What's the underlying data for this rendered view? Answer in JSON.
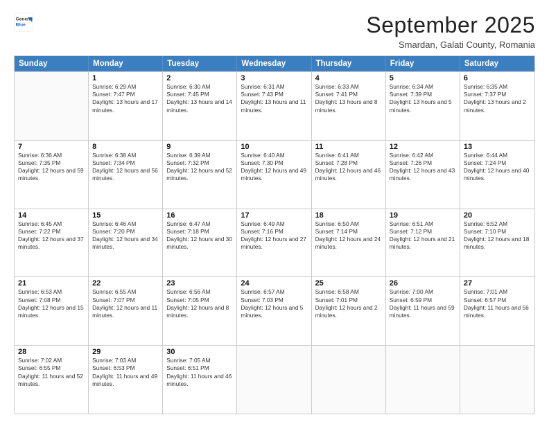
{
  "logo": {
    "general": "General",
    "blue": "Blue"
  },
  "header": {
    "month": "September 2025",
    "location": "Smardan, Galati County, Romania"
  },
  "weekdays": [
    "Sunday",
    "Monday",
    "Tuesday",
    "Wednesday",
    "Thursday",
    "Friday",
    "Saturday"
  ],
  "weeks": [
    [
      {
        "date": "",
        "sunrise": "",
        "sunset": "",
        "daylight": ""
      },
      {
        "date": "1",
        "sunrise": "Sunrise: 6:29 AM",
        "sunset": "Sunset: 7:47 PM",
        "daylight": "Daylight: 13 hours and 17 minutes."
      },
      {
        "date": "2",
        "sunrise": "Sunrise: 6:30 AM",
        "sunset": "Sunset: 7:45 PM",
        "daylight": "Daylight: 13 hours and 14 minutes."
      },
      {
        "date": "3",
        "sunrise": "Sunrise: 6:31 AM",
        "sunset": "Sunset: 7:43 PM",
        "daylight": "Daylight: 13 hours and 11 minutes."
      },
      {
        "date": "4",
        "sunrise": "Sunrise: 6:33 AM",
        "sunset": "Sunset: 7:41 PM",
        "daylight": "Daylight: 13 hours and 8 minutes."
      },
      {
        "date": "5",
        "sunrise": "Sunrise: 6:34 AM",
        "sunset": "Sunset: 7:39 PM",
        "daylight": "Daylight: 13 hours and 5 minutes."
      },
      {
        "date": "6",
        "sunrise": "Sunrise: 6:35 AM",
        "sunset": "Sunset: 7:37 PM",
        "daylight": "Daylight: 13 hours and 2 minutes."
      }
    ],
    [
      {
        "date": "7",
        "sunrise": "Sunrise: 6:36 AM",
        "sunset": "Sunset: 7:35 PM",
        "daylight": "Daylight: 12 hours and 59 minutes."
      },
      {
        "date": "8",
        "sunrise": "Sunrise: 6:38 AM",
        "sunset": "Sunset: 7:34 PM",
        "daylight": "Daylight: 12 hours and 56 minutes."
      },
      {
        "date": "9",
        "sunrise": "Sunrise: 6:39 AM",
        "sunset": "Sunset: 7:32 PM",
        "daylight": "Daylight: 12 hours and 52 minutes."
      },
      {
        "date": "10",
        "sunrise": "Sunrise: 6:40 AM",
        "sunset": "Sunset: 7:30 PM",
        "daylight": "Daylight: 12 hours and 49 minutes."
      },
      {
        "date": "11",
        "sunrise": "Sunrise: 6:41 AM",
        "sunset": "Sunset: 7:28 PM",
        "daylight": "Daylight: 12 hours and 46 minutes."
      },
      {
        "date": "12",
        "sunrise": "Sunrise: 6:42 AM",
        "sunset": "Sunset: 7:26 PM",
        "daylight": "Daylight: 12 hours and 43 minutes."
      },
      {
        "date": "13",
        "sunrise": "Sunrise: 6:44 AM",
        "sunset": "Sunset: 7:24 PM",
        "daylight": "Daylight: 12 hours and 40 minutes."
      }
    ],
    [
      {
        "date": "14",
        "sunrise": "Sunrise: 6:45 AM",
        "sunset": "Sunset: 7:22 PM",
        "daylight": "Daylight: 12 hours and 37 minutes."
      },
      {
        "date": "15",
        "sunrise": "Sunrise: 6:46 AM",
        "sunset": "Sunset: 7:20 PM",
        "daylight": "Daylight: 12 hours and 34 minutes."
      },
      {
        "date": "16",
        "sunrise": "Sunrise: 6:47 AM",
        "sunset": "Sunset: 7:18 PM",
        "daylight": "Daylight: 12 hours and 30 minutes."
      },
      {
        "date": "17",
        "sunrise": "Sunrise: 6:49 AM",
        "sunset": "Sunset: 7:16 PM",
        "daylight": "Daylight: 12 hours and 27 minutes."
      },
      {
        "date": "18",
        "sunrise": "Sunrise: 6:50 AM",
        "sunset": "Sunset: 7:14 PM",
        "daylight": "Daylight: 12 hours and 24 minutes."
      },
      {
        "date": "19",
        "sunrise": "Sunrise: 6:51 AM",
        "sunset": "Sunset: 7:12 PM",
        "daylight": "Daylight: 12 hours and 21 minutes."
      },
      {
        "date": "20",
        "sunrise": "Sunrise: 6:52 AM",
        "sunset": "Sunset: 7:10 PM",
        "daylight": "Daylight: 12 hours and 18 minutes."
      }
    ],
    [
      {
        "date": "21",
        "sunrise": "Sunrise: 6:53 AM",
        "sunset": "Sunset: 7:08 PM",
        "daylight": "Daylight: 12 hours and 15 minutes."
      },
      {
        "date": "22",
        "sunrise": "Sunrise: 6:55 AM",
        "sunset": "Sunset: 7:07 PM",
        "daylight": "Daylight: 12 hours and 11 minutes."
      },
      {
        "date": "23",
        "sunrise": "Sunrise: 6:56 AM",
        "sunset": "Sunset: 7:05 PM",
        "daylight": "Daylight: 12 hours and 8 minutes."
      },
      {
        "date": "24",
        "sunrise": "Sunrise: 6:57 AM",
        "sunset": "Sunset: 7:03 PM",
        "daylight": "Daylight: 12 hours and 5 minutes."
      },
      {
        "date": "25",
        "sunrise": "Sunrise: 6:58 AM",
        "sunset": "Sunset: 7:01 PM",
        "daylight": "Daylight: 12 hours and 2 minutes."
      },
      {
        "date": "26",
        "sunrise": "Sunrise: 7:00 AM",
        "sunset": "Sunset: 6:59 PM",
        "daylight": "Daylight: 11 hours and 59 minutes."
      },
      {
        "date": "27",
        "sunrise": "Sunrise: 7:01 AM",
        "sunset": "Sunset: 6:57 PM",
        "daylight": "Daylight: 11 hours and 56 minutes."
      }
    ],
    [
      {
        "date": "28",
        "sunrise": "Sunrise: 7:02 AM",
        "sunset": "Sunset: 6:55 PM",
        "daylight": "Daylight: 11 hours and 52 minutes."
      },
      {
        "date": "29",
        "sunrise": "Sunrise: 7:03 AM",
        "sunset": "Sunset: 6:53 PM",
        "daylight": "Daylight: 11 hours and 49 minutes."
      },
      {
        "date": "30",
        "sunrise": "Sunrise: 7:05 AM",
        "sunset": "Sunset: 6:51 PM",
        "daylight": "Daylight: 11 hours and 46 minutes."
      },
      {
        "date": "",
        "sunrise": "",
        "sunset": "",
        "daylight": ""
      },
      {
        "date": "",
        "sunrise": "",
        "sunset": "",
        "daylight": ""
      },
      {
        "date": "",
        "sunrise": "",
        "sunset": "",
        "daylight": ""
      },
      {
        "date": "",
        "sunrise": "",
        "sunset": "",
        "daylight": ""
      }
    ]
  ]
}
